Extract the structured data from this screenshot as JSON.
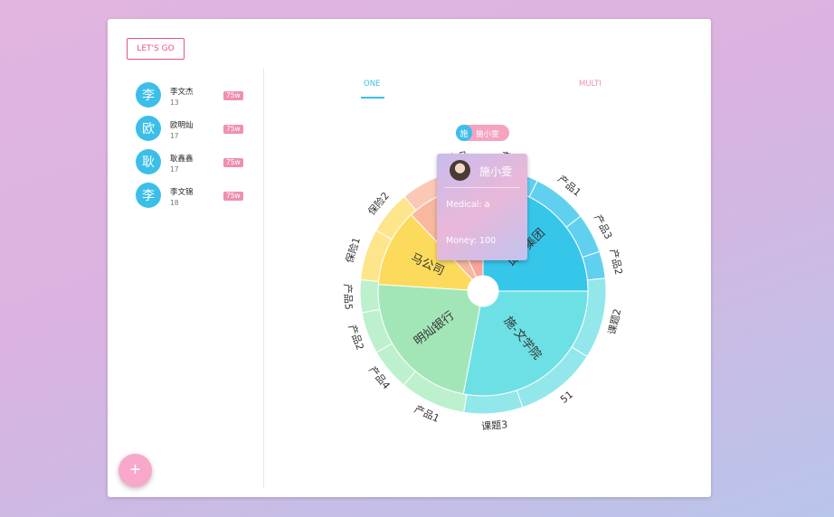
{
  "header": {
    "lets_go_label": "LET'S GO"
  },
  "users": [
    {
      "avatar": "李",
      "name": "李文杰",
      "age": "13",
      "badge": "75w"
    },
    {
      "avatar": "欧",
      "name": "欧明灿",
      "age": "17",
      "badge": "75w"
    },
    {
      "avatar": "耿",
      "name": "耿鑫鑫",
      "age": "17",
      "badge": "75w"
    },
    {
      "avatar": "李",
      "name": "李文锦",
      "age": "18",
      "badge": "75w"
    }
  ],
  "tabs": {
    "one": "ONE",
    "multi": "MULTI"
  },
  "chip": {
    "avatar": "施",
    "label": "施小雯"
  },
  "tooltip": {
    "name": "施小雯",
    "medical": "Medical: a",
    "money": "Money: 100"
  },
  "fab": {
    "label": "+"
  },
  "colors": {
    "accent_blue": "#3bbfe9",
    "accent_pink": "#f08fb0",
    "border_pink": "#e8508f"
  },
  "chart_data": {
    "type": "sunburst",
    "inner": [
      {
        "name": "邱少集团",
        "value": 25,
        "color": "#36c6ea"
      },
      {
        "name": "施-文学院",
        "value": 28,
        "color": "#6de0e5"
      },
      {
        "name": "明灿银行",
        "value": 23,
        "color": "#a2e6b8"
      },
      {
        "name": "马公司",
        "value": 12,
        "color": "#fcdb5c"
      },
      {
        "name": "年",
        "value": 5,
        "color": "#f7b89e"
      },
      {
        "name": "",
        "value": 7,
        "color": "#f9a59a"
      }
    ],
    "outer": [
      {
        "name": "产品5",
        "value": 7.0,
        "color": "#61d0ef"
      },
      {
        "name": "产品1",
        "value": 7.0,
        "color": "#61d0ef"
      },
      {
        "name": "产品3",
        "value": 5.0,
        "color": "#61d0ef"
      },
      {
        "name": "产品2",
        "value": 3.4,
        "color": "#61d0ef"
      },
      {
        "name": "课题2",
        "value": 10.2,
        "color": "#92e7ea"
      },
      {
        "name": "51",
        "value": 10.4,
        "color": "#92e7ea"
      },
      {
        "name": "课题3",
        "value": 7.4,
        "color": "#92e7ea"
      },
      {
        "name": "产品1",
        "value": 8.3,
        "color": "#bdf0cd"
      },
      {
        "name": "产品4",
        "value": 5.3,
        "color": "#bdf0cd"
      },
      {
        "name": "产品2",
        "value": 5.3,
        "color": "#bdf0cd"
      },
      {
        "name": "产品5",
        "value": 4.1,
        "color": "#bdf0cd"
      },
      {
        "name": "保险1",
        "value": 6.5,
        "color": "#fde58c"
      },
      {
        "name": "保险2",
        "value": 5.5,
        "color": "#fde58c"
      },
      {
        "name": "",
        "value": 5.0,
        "color": "#fbc8b6"
      },
      {
        "name": "产品",
        "value": 5.6,
        "color": "#61d0ef"
      }
    ]
  }
}
